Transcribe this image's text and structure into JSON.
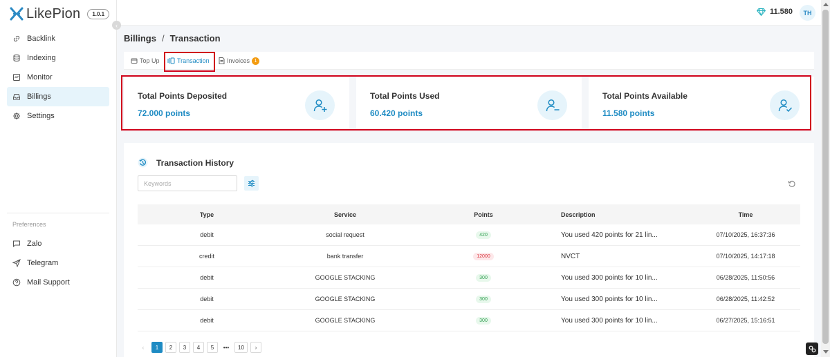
{
  "app": {
    "name": "LikePion",
    "version": "1.0.1"
  },
  "sidebar": {
    "items": [
      {
        "label": "Backlink",
        "icon": "link-icon"
      },
      {
        "label": "Indexing",
        "icon": "database-icon"
      },
      {
        "label": "Monitor",
        "icon": "chart-square-icon"
      },
      {
        "label": "Billings",
        "icon": "inbox-icon",
        "active": true
      },
      {
        "label": "Settings",
        "icon": "gear-icon"
      }
    ],
    "preferences_label": "Preferences",
    "preferences": [
      {
        "label": "Zalo",
        "icon": "chat-icon"
      },
      {
        "label": "Telegram",
        "icon": "send-icon"
      },
      {
        "label": "Mail Support",
        "icon": "help-circle-icon"
      }
    ]
  },
  "header": {
    "balance": "11.580",
    "avatar_initials": "TH"
  },
  "breadcrumb": {
    "parent": "Billings",
    "separator": "/",
    "current": "Transaction"
  },
  "tabs": [
    {
      "label": "Top Up"
    },
    {
      "label": "Transaction",
      "active": true
    },
    {
      "label": "Invoices",
      "badge": "1"
    }
  ],
  "stats": [
    {
      "title": "Total Points Deposited",
      "value": "72.000 points"
    },
    {
      "title": "Total Points Used",
      "value": "60.420 points"
    },
    {
      "title": "Total Points Available",
      "value": "11.580 points"
    }
  ],
  "history": {
    "title": "Transaction History",
    "search_placeholder": "Keywords",
    "columns": [
      "Type",
      "Service",
      "Points",
      "Description",
      "Time"
    ],
    "rows": [
      {
        "type": "debit",
        "service": "social request",
        "points": "420",
        "description": "You used 420 points for 21 lin...",
        "time": "07/10/2025, 16:37:36"
      },
      {
        "type": "credit",
        "service": "bank transfer",
        "points": "12000",
        "description": "NVCT",
        "time": "07/10/2025, 14:17:18"
      },
      {
        "type": "debit",
        "service": "GOOGLE STACKING",
        "points": "300",
        "description": "You used 300 points for 10 lin...",
        "time": "06/28/2025, 11:50:56"
      },
      {
        "type": "debit",
        "service": "GOOGLE STACKING",
        "points": "300",
        "description": "You used 300 points for 10 lin...",
        "time": "06/28/2025, 11:42:52"
      },
      {
        "type": "debit",
        "service": "GOOGLE STACKING",
        "points": "300",
        "description": "You used 300 points for 10 lin...",
        "time": "06/27/2025, 15:16:51"
      }
    ],
    "pagination": {
      "prev": "‹",
      "pages": [
        "1",
        "2",
        "3",
        "4",
        "5"
      ],
      "ellipsis": "•••",
      "last": "10",
      "next": "›",
      "current": "1"
    }
  },
  "colors": {
    "accent": "#1e8bc3",
    "highlight": "#d0021b",
    "debit": "#2e9e4e",
    "credit": "#d9363e",
    "badge": "#f39c12"
  }
}
